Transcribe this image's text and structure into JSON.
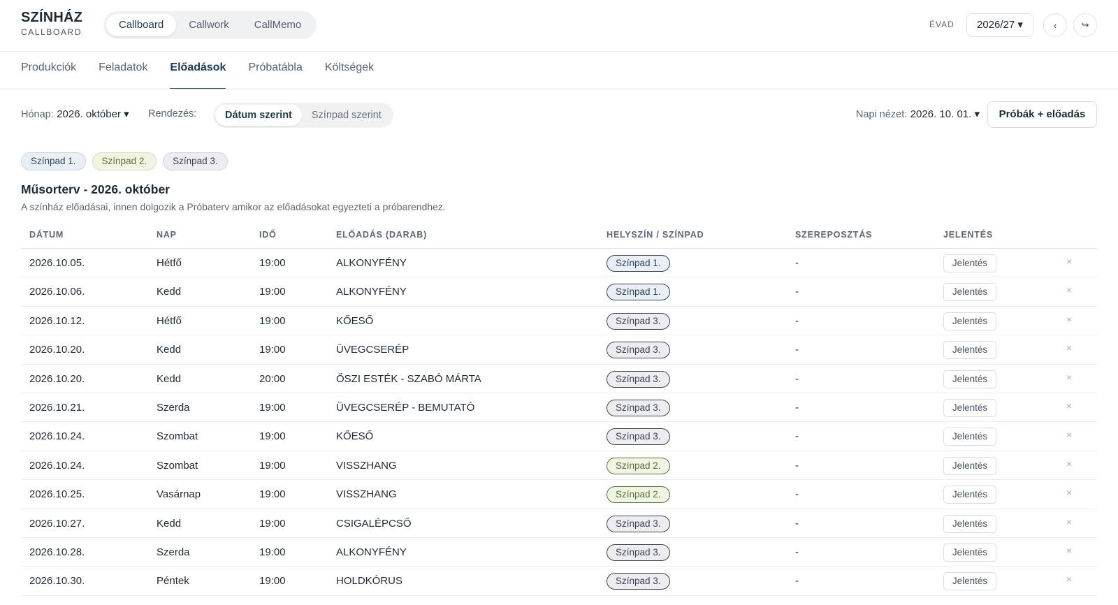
{
  "brand": {
    "title": "SZÍNHÁZ",
    "subtitle": "CALLBOARD"
  },
  "app_switch": [
    {
      "label": "Callboard",
      "active": true
    },
    {
      "label": "Callwork",
      "active": false
    },
    {
      "label": "CallMemo",
      "active": false
    }
  ],
  "season": {
    "label": "ÉVAD",
    "value": "2026/27 ▾",
    "prev_icon": "‹",
    "exit_icon": "↪"
  },
  "tabs": [
    {
      "label": "Produkciók",
      "active": false
    },
    {
      "label": "Feladatok",
      "active": false
    },
    {
      "label": "Előadások",
      "active": true
    },
    {
      "label": "Próbatábla",
      "active": false
    },
    {
      "label": "Költségek",
      "active": false
    }
  ],
  "filters": {
    "month_label": "Hónap:",
    "month_value": "2026. október ▾",
    "sort_label": "Rendezés:",
    "sort_options": [
      {
        "label": "Dátum szerint",
        "active": true
      },
      {
        "label": "Színpad szerint",
        "active": false
      }
    ],
    "day_view_label": "Napi nézet:",
    "day_view_value": "2026. 10. 01. ▾",
    "primary_button": "Próbák + előadás"
  },
  "stages": [
    {
      "label": "Színpad 1.",
      "color": "#e9eff4"
    },
    {
      "label": "Színpad 2.",
      "color": "#eff4e3"
    },
    {
      "label": "Színpad 3.",
      "color": "#ececf1"
    }
  ],
  "section": {
    "title": "Műsorterv - 2026. október",
    "description": "A színház előadásai, innen dolgozik a Próbaterv amikor az előadásokat egyezteti a próbarendhez."
  },
  "table": {
    "headers": {
      "date": "DÁTUM",
      "day": "NAP",
      "time": "IDŐ",
      "show": "ELŐADÁS (DARAB)",
      "venue": "HELYSZÍN / SZÍNPAD",
      "cast": "SZEREPOSZTÁS",
      "report": "JELENTÉS"
    },
    "report_label": "Jelentés",
    "delete_icon": "×",
    "rows": [
      {
        "date": "2026.10.05.",
        "day": "Hétfő",
        "time": "19:00",
        "show": "ALKONYFÉNY",
        "venue": "Színpad 1.",
        "cast": "-"
      },
      {
        "date": "2026.10.06.",
        "day": "Kedd",
        "time": "19:00",
        "show": "ALKONYFÉNY",
        "venue": "Színpad 1.",
        "cast": "-"
      },
      {
        "date": "2026.10.12.",
        "day": "Hétfő",
        "time": "19:00",
        "show": "KŐESŐ",
        "venue": "Színpad 3.",
        "cast": "-"
      },
      {
        "date": "2026.10.20.",
        "day": "Kedd",
        "time": "19:00",
        "show": "ÜVEGCSERÉP",
        "venue": "Színpad 3.",
        "cast": "-"
      },
      {
        "date": "2026.10.20.",
        "day": "Kedd",
        "time": "20:00",
        "show": "ŐSZI ESTÉK - SZABÓ MÁRTA",
        "venue": "Színpad 3.",
        "cast": "-"
      },
      {
        "date": "2026.10.21.",
        "day": "Szerda",
        "time": "19:00",
        "show": "ÜVEGCSERÉP - BEMUTATÓ",
        "venue": "Színpad 3.",
        "cast": "-"
      },
      {
        "date": "2026.10.24.",
        "day": "Szombat",
        "time": "19:00",
        "show": "KŐESŐ",
        "venue": "Színpad 3.",
        "cast": "-"
      },
      {
        "date": "2026.10.24.",
        "day": "Szombat",
        "time": "19:00",
        "show": "VISSZHANG",
        "venue": "Színpad 2.",
        "cast": "-"
      },
      {
        "date": "2026.10.25.",
        "day": "Vasárnap",
        "time": "19:00",
        "show": "VISSZHANG",
        "venue": "Színpad 2.",
        "cast": "-"
      },
      {
        "date": "2026.10.27.",
        "day": "Kedd",
        "time": "19:00",
        "show": "CSIGALÉPCSŐ",
        "venue": "Színpad 3.",
        "cast": "-"
      },
      {
        "date": "2026.10.28.",
        "day": "Szerda",
        "time": "19:00",
        "show": "ALKONYFÉNY",
        "venue": "Színpad 3.",
        "cast": "-"
      },
      {
        "date": "2026.10.30.",
        "day": "Péntek",
        "time": "19:00",
        "show": "HOLDKÓRUS",
        "venue": "Színpad 3.",
        "cast": "-"
      }
    ]
  }
}
